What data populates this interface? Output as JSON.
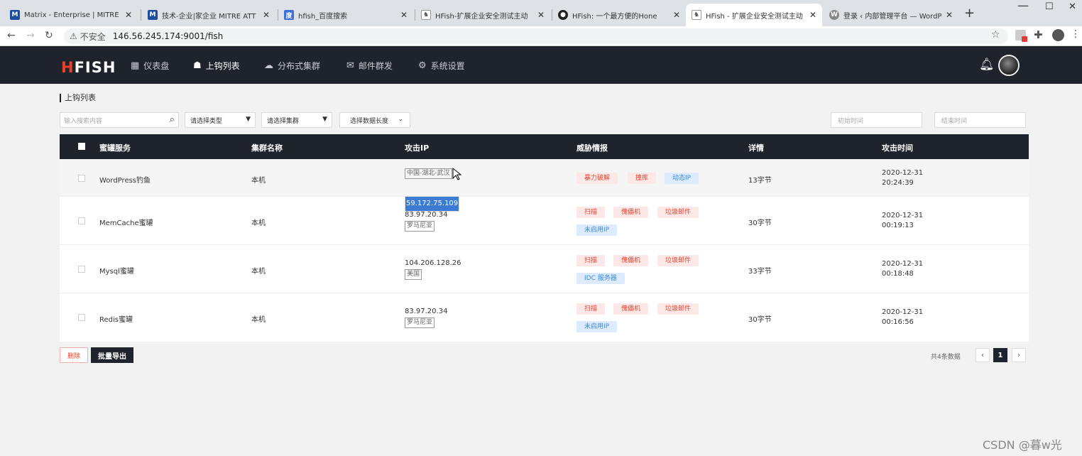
{
  "browser": {
    "tabs": [
      {
        "title": "Matrix - Enterprise | MITRE A",
        "icon": "mitre-icon",
        "color": "#1d4e9e"
      },
      {
        "title": "技术-企业|家企业 MITRE ATT",
        "icon": "mitre-icon",
        "color": "#1d4e9e"
      },
      {
        "title": "hfish_百度搜索",
        "icon": "baidu-icon",
        "color": "#3b6fd9"
      },
      {
        "title": "HFish-扩展企业安全测试主动",
        "icon": "hfish-icon",
        "color": "#555555"
      },
      {
        "title": "HFish: 一个最方便的Hone",
        "icon": "github-icon",
        "color": "#222222"
      },
      {
        "title": "HFish - 扩展企业安全测试主动",
        "icon": "hfish-icon",
        "color": "#555555"
      },
      {
        "title": "登录 ‹ 内部管理平台 — WordP",
        "icon": "wordpress-icon",
        "color": "#666666"
      }
    ],
    "active_tab": 5,
    "insecure_label": "不安全",
    "url": "146.56.245.174:9001/fish"
  },
  "header": {
    "logo_left": "H",
    "logo_right": "FISH",
    "nav": [
      {
        "label": "仪表盘",
        "icon": "dashboard-icon"
      },
      {
        "label": "上钩列表",
        "icon": "fish-list-icon"
      },
      {
        "label": "分布式集群",
        "icon": "cloud-icon"
      },
      {
        "label": "邮件群发",
        "icon": "mail-icon"
      },
      {
        "label": "系统设置",
        "icon": "gear-icon"
      }
    ],
    "active_nav": 1
  },
  "page": {
    "title": "上钩列表",
    "search_placeholder": "输入搜索内容",
    "filter_type": "请选择类型",
    "filter_cluster": "请选择集群",
    "filter_length": "选择数据长度",
    "start_time_placeholder": "初始时间",
    "end_time_placeholder": "结束时间"
  },
  "table": {
    "columns": [
      "蜜罐服务",
      "集群名称",
      "攻击IP",
      "威胁情报",
      "详情",
      "攻击时间"
    ],
    "rows": [
      {
        "service": "WordPress钓鱼",
        "cluster": "本机",
        "ip": "59.172.75.109",
        "location": "中国-湖北-武汉",
        "tags": [
          {
            "label": "暴力破解",
            "color": "red"
          },
          {
            "label": "撞库",
            "color": "red"
          },
          {
            "label": "动态IP",
            "color": "blue"
          }
        ],
        "detail": "13字节",
        "date": "2020-12-31",
        "time": "20:24:39"
      },
      {
        "service": "MemCache蜜罐",
        "cluster": "本机",
        "ip": "83.97.20.34",
        "location": "罗马尼亚",
        "tags": [
          {
            "label": "扫描",
            "color": "red"
          },
          {
            "label": "傀儡机",
            "color": "red"
          },
          {
            "label": "垃圾邮件",
            "color": "red"
          },
          {
            "label": "未启用IP",
            "color": "blue"
          }
        ],
        "detail": "30字节",
        "date": "2020-12-31",
        "time": "00:19:13"
      },
      {
        "service": "Mysql蜜罐",
        "cluster": "本机",
        "ip": "104.206.128.26",
        "location": "美国",
        "tags": [
          {
            "label": "扫描",
            "color": "red"
          },
          {
            "label": "傀儡机",
            "color": "red"
          },
          {
            "label": "垃圾邮件",
            "color": "red"
          },
          {
            "label": "IDC 服务器",
            "color": "blue"
          }
        ],
        "detail": "33字节",
        "date": "2020-12-31",
        "time": "00:18:48"
      },
      {
        "service": "Redis蜜罐",
        "cluster": "本机",
        "ip": "83.97.20.34",
        "location": "罗马尼亚",
        "tags": [
          {
            "label": "扫描",
            "color": "red"
          },
          {
            "label": "傀儡机",
            "color": "red"
          },
          {
            "label": "垃圾邮件",
            "color": "red"
          },
          {
            "label": "未启用IP",
            "color": "blue"
          }
        ],
        "detail": "30字节",
        "date": "2020-12-31",
        "time": "00:16:56"
      }
    ]
  },
  "footer": {
    "delete_label": "删除",
    "export_label": "批量导出",
    "total_label": "共4条数据",
    "current_page": "1"
  },
  "watermark": "CSDN @暮w光"
}
